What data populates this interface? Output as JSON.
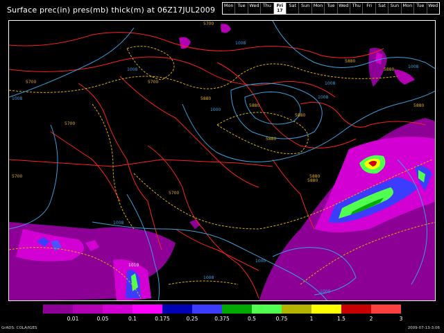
{
  "title": "Surface prec(in) pres(mb) thick(m) at 06Z17JUL2009",
  "day_nav": [
    {
      "label": "Mon"
    },
    {
      "label": "Tue"
    },
    {
      "label": "Wed"
    },
    {
      "label": "Thu"
    },
    {
      "label": "Fri",
      "num": "17",
      "selected": true
    },
    {
      "label": "Sat"
    },
    {
      "label": "Sun"
    },
    {
      "label": "Mon"
    },
    {
      "label": "Tue"
    },
    {
      "label": "Wed"
    },
    {
      "label": "Thu"
    },
    {
      "label": "Fri"
    },
    {
      "label": "Sat"
    },
    {
      "label": "Sun"
    },
    {
      "label": "Mon"
    },
    {
      "label": "Tue"
    },
    {
      "label": "Wed"
    }
  ],
  "contour_labels": {
    "pressure": [
      "1008",
      "1008",
      "1008",
      "1008",
      "1008",
      "1000",
      "1008",
      "1008",
      "1010",
      "1008",
      "1000",
      "1000"
    ],
    "thickness": [
      "5700",
      "5700",
      "5700",
      "5880",
      "5880",
      "5880",
      "5880",
      "5880",
      "5880",
      "5880",
      "5880",
      "5880",
      "5700",
      "5700",
      "5700"
    ]
  },
  "colorbar": {
    "colors": [
      "#8c0096",
      "#b400b4",
      "#d200d2",
      "#ff00ff",
      "#0000b4",
      "#3c3cff",
      "#00aa00",
      "#50ff50",
      "#b4b400",
      "#ffff00",
      "#c80000",
      "#ff4040"
    ],
    "ticks": [
      "0.01",
      "0.05",
      "0.1",
      "0.175",
      "0.25",
      "0.375",
      "0.5",
      "0.75",
      "1",
      "1.5",
      "2",
      "3"
    ]
  },
  "footer": {
    "left": "GrADS: COLA/IGES",
    "right": "2009-07-13-3:06"
  }
}
